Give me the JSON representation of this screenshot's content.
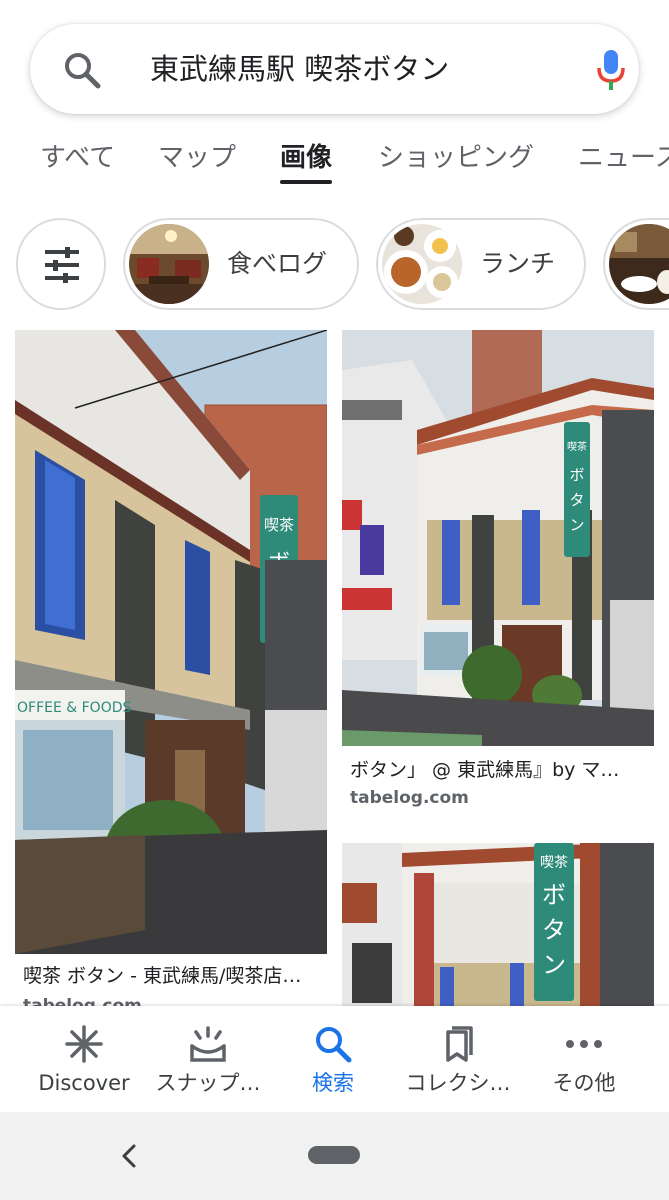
{
  "search": {
    "query": "東武練馬駅 喫茶ボタン"
  },
  "tabs": [
    {
      "label": "すべて",
      "active": false
    },
    {
      "label": "マップ",
      "active": false
    },
    {
      "label": "画像",
      "active": true
    },
    {
      "label": "ショッピング",
      "active": false
    },
    {
      "label": "ニュース",
      "active": false
    }
  ],
  "chips": [
    {
      "label": "食べログ"
    },
    {
      "label": "ランチ"
    }
  ],
  "results": [
    {
      "title": "喫茶 ボタン - 東武練馬/喫茶店…",
      "source": "tabelog.com",
      "sign_text": "喫茶ボタン",
      "awning_text": "OFFEE & FOODS"
    },
    {
      "title": "ボタン」 @ 東武練馬』by マ…",
      "source": "tabelog.com",
      "sign_text": "喫茶ボタン"
    },
    {
      "sign_text": "喫茶ボタン"
    }
  ],
  "bottom_nav": [
    {
      "label": "Discover",
      "icon": "asterisk-icon",
      "active": false
    },
    {
      "label": "スナップ…",
      "icon": "lens-icon",
      "active": false
    },
    {
      "label": "検索",
      "icon": "search-icon",
      "active": true
    },
    {
      "label": "コレクシ…",
      "icon": "collections-icon",
      "active": false
    },
    {
      "label": "その他",
      "icon": "more-icon",
      "active": false
    }
  ],
  "colors": {
    "accent": "#1a73e8",
    "text_primary": "#202124",
    "text_secondary": "#5f6368",
    "sign_green": "#2e8b7a"
  }
}
